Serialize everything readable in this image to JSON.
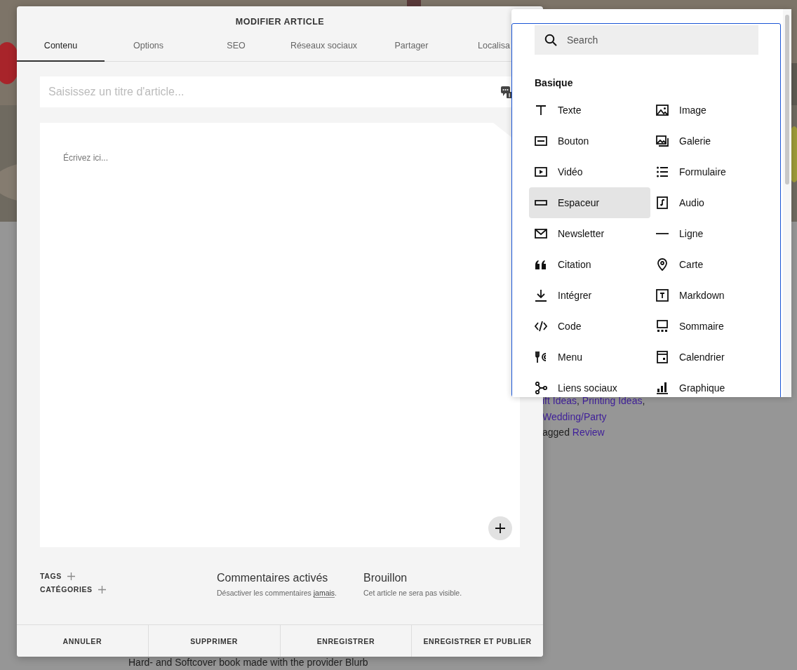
{
  "background_page": {
    "category_line": [
      {
        "text": "ift Ideas",
        "link": true
      },
      {
        "text": ", ",
        "link": false
      },
      {
        "text": "Printing Ideas",
        "link": true
      },
      {
        "text": ",",
        "link": false
      }
    ],
    "category_line_2": [
      {
        "text": "Wedding/Party",
        "link": true
      }
    ],
    "tag_line": [
      {
        "text": "agged ",
        "link": false
      },
      {
        "text": "Review",
        "link": true
      }
    ],
    "description": "Hard- and Softcover book made with the provider Blurb"
  },
  "modal": {
    "title": "MODIFIER ARTICLE",
    "tabs": [
      {
        "label": "Contenu",
        "selected": true
      },
      {
        "label": "Options",
        "selected": false
      },
      {
        "label": "SEO",
        "selected": false
      },
      {
        "label": "Réseaux sociaux",
        "selected": false
      },
      {
        "label": "Partager",
        "selected": false
      },
      {
        "label": "Localisa",
        "selected": false
      }
    ],
    "title_field": {
      "placeholder": "Saisissez un titre d'article..."
    },
    "body_field": {
      "placeholder": "Écrivez ici..."
    },
    "tags_label": "TAGS",
    "categories_label": "CATÉGORIES",
    "comments": {
      "title": "Commentaires activés",
      "text": "Désactiver les commentaires",
      "link": "jamais",
      "end": "."
    },
    "status": {
      "title": "Brouillon",
      "text": "Cet article ne sera pas visible."
    },
    "buttons": [
      "ANNULER",
      "SUPPRIMER",
      "ENREGISTRER",
      "ENREGISTRER ET PUBLIER"
    ]
  },
  "block_picker": {
    "search": {
      "placeholder": "Search"
    },
    "section": "Basique",
    "blocks": [
      {
        "label": "Texte",
        "selected": false
      },
      {
        "label": "Image",
        "selected": false
      },
      {
        "label": "Bouton",
        "selected": false
      },
      {
        "label": "Galerie",
        "selected": false
      },
      {
        "label": "Vidéo",
        "selected": false
      },
      {
        "label": "Formulaire",
        "selected": false
      },
      {
        "label": "Espaceur",
        "selected": true
      },
      {
        "label": "Audio",
        "selected": false
      },
      {
        "label": "Newsletter",
        "selected": false
      },
      {
        "label": "Ligne",
        "selected": false
      },
      {
        "label": "Citation",
        "selected": false
      },
      {
        "label": "Carte",
        "selected": false
      },
      {
        "label": "Intégrer",
        "selected": false
      },
      {
        "label": "Markdown",
        "selected": false
      },
      {
        "label": "Code",
        "selected": false
      },
      {
        "label": "Sommaire",
        "selected": false
      },
      {
        "label": "Menu",
        "selected": false
      },
      {
        "label": "Calendrier",
        "selected": false
      },
      {
        "label": "Liens sociaux",
        "selected": false
      },
      {
        "label": "Graphique",
        "selected": false
      }
    ]
  }
}
